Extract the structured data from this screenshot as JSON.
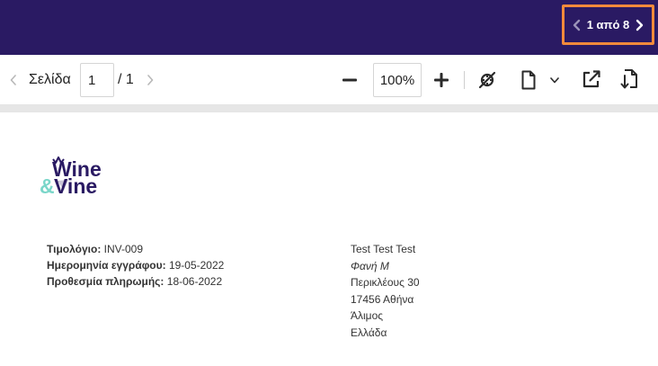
{
  "header": {
    "pager_text": "1 από 8",
    "accent_color": "#f38a3b",
    "bar_color": "#2a1a63"
  },
  "toolbar": {
    "page_label": "Σελίδα",
    "page_value": "1",
    "page_total": "/ 1",
    "zoom_value": "100%",
    "icons": [
      "chevron-left-icon",
      "chevron-right-icon",
      "minus-icon",
      "plus-icon",
      "hide-annotations-icon",
      "document-icon",
      "chevron-down-icon",
      "open-external-icon",
      "download-icon"
    ]
  },
  "document": {
    "logo_text_top": "Wine",
    "logo_text_bottom": "&Vine",
    "invoice_label": "Τιμολόγιο:",
    "invoice_value": "INV-009",
    "date_label": "Ημερομηνία εγγράφου:",
    "date_value": "19-05-2022",
    "due_label": "Προθεσμία πληρωμής:",
    "due_value": "18-06-2022",
    "address": {
      "name": "Test Test Test",
      "contact": "Φανή Μ",
      "street": "Περικλέους 30",
      "city": "17456 Αθήνα",
      "area": "Άλιμος",
      "country": "Ελλάδα"
    }
  }
}
